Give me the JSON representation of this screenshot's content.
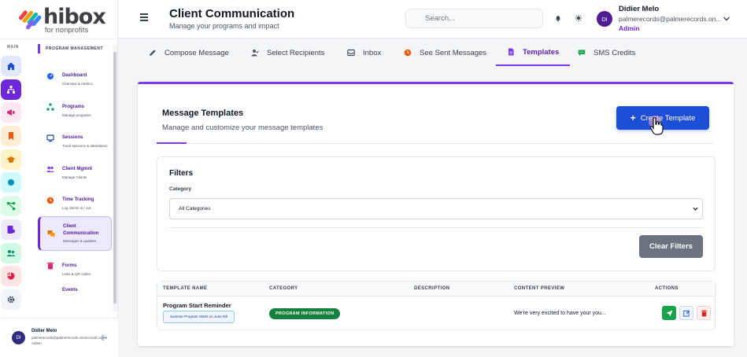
{
  "brand": {
    "name": "hibox",
    "tagline": "for nonprofits"
  },
  "sidebar": {
    "rail_label": "MAIN",
    "section_title": "PROGRAM MANAGEMENT",
    "rail_icons": [
      "home-icon",
      "org-chart-icon",
      "megaphone-icon",
      "bookmark-icon",
      "graduation-cap-icon",
      "circle-icon",
      "flow-icon",
      "document-user-icon",
      "users-icon",
      "pie-chart-icon",
      "gear-icon"
    ],
    "items": [
      {
        "title": "Dashboard",
        "sub": "Overview & metrics",
        "icon": "dashboard-icon"
      },
      {
        "title": "Programs",
        "sub": "Manage programs",
        "icon": "programs-icon"
      },
      {
        "title": "Sessions",
        "sub": "Track sessions & attendance",
        "icon": "sessions-icon"
      },
      {
        "title": "Client Mgmnt",
        "sub": "Manage Clients",
        "icon": "client-icon"
      },
      {
        "title": "Time Tracking",
        "sub": "Log clients in / out",
        "icon": "clock-icon"
      },
      {
        "title": "Client Communication",
        "sub": "Messages & updates",
        "icon": "chat-icon"
      },
      {
        "title": "Forms",
        "sub": "Links & QR codes",
        "icon": "trash-icon"
      },
      {
        "title": "Events",
        "sub": "",
        "icon": "calendar-icon"
      }
    ],
    "footer": {
      "initials": "DI",
      "name": "Didier Melo",
      "email": "palmerecords@palmerecords.onmicrosoft.com",
      "role": "Admin"
    }
  },
  "header": {
    "title": "Client Communication",
    "subtitle": "Manage your programs and impact",
    "search_placeholder": "Search...",
    "user": {
      "initials": "DI",
      "name": "Didier Melo",
      "email": "palmerecords@palmerecords.on...",
      "role": "Admin"
    }
  },
  "tabs": [
    {
      "label": "Compose Message",
      "icon": "pencil-icon"
    },
    {
      "label": "Select Recipients",
      "icon": "user-check-icon"
    },
    {
      "label": "Inbox",
      "icon": "inbox-icon"
    },
    {
      "label": "See Sent Messages",
      "icon": "clock-icon"
    },
    {
      "label": "Templates",
      "icon": "file-icon",
      "active": true
    },
    {
      "label": "SMS Credits",
      "icon": "sms-icon"
    }
  ],
  "templates": {
    "title": "Message Templates",
    "subtitle": "Manage and customize your message templates",
    "create_label": "Create Template",
    "filters": {
      "title": "Filters",
      "category_label": "Category",
      "category_value": "All Categories",
      "clear_label": "Clear Filters"
    },
    "table": {
      "headers": [
        "TEMPLATE NAME",
        "CATEGORY",
        "DESCRIPTION",
        "CONTENT PREVIEW",
        "ACTIONS"
      ],
      "rows": [
        {
          "name": "Program Start Reminder",
          "tag": "Summer Program Starts on June 6th",
          "category": "PROGRAM INFORMATION",
          "description": "",
          "preview": "We're very excited to have your you..."
        }
      ]
    }
  },
  "colors": {
    "accent": "#7c3aed",
    "primary": "#1d4ed8",
    "success": "#15803d",
    "danger": "#dc2626"
  }
}
